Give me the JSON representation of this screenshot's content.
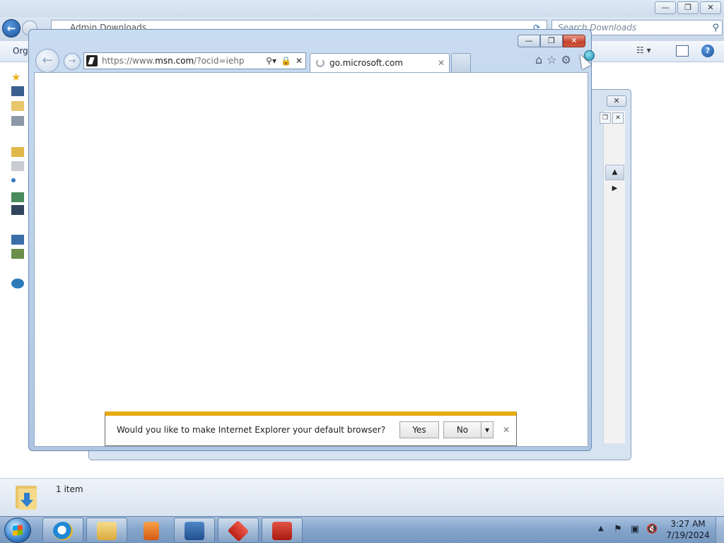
{
  "explorer": {
    "breadcrumb": [
      "Admin",
      "Downloads"
    ],
    "search_placeholder": "Search Downloads",
    "toolbar": {
      "organize_label": "Organize ▾",
      "views_icon": "views-icon",
      "pane_icon": "preview-pane-icon",
      "help_label": "?"
    },
    "title_buttons": {
      "minimize": "—",
      "restore": "❐",
      "close": "✕"
    },
    "status": {
      "item_count": "1 item"
    }
  },
  "ie": {
    "title_buttons": {
      "minimize": "—",
      "restore": "❐",
      "close": "✕"
    },
    "address": {
      "prefix": "https://www.",
      "domain": "msn.com",
      "suffix": "/?ocid=iehp"
    },
    "address_tools": {
      "search": "⚲▾",
      "lock": "🔒",
      "stop": "✕"
    },
    "tab": {
      "label": "go.microsoft.com",
      "close": "✕"
    },
    "commands": {
      "home": "⌂",
      "favorites": "☆",
      "tools": "⚙"
    },
    "notification": {
      "message": "Would you like to make Internet Explorer your default browser?",
      "yes_label": "Yes",
      "no_label": "No",
      "dropdown_label": "▾",
      "close_label": "✕"
    }
  },
  "taskbar": {
    "apps": [
      "internet-explorer",
      "windows-explorer",
      "media-player",
      "server-manager",
      "toolbox",
      "toolbox-2"
    ],
    "tray_arrow": "▲",
    "time": "3:27 AM",
    "date": "7/19/2024"
  },
  "colors": {
    "notification_accent": "#e6aa12",
    "close_red": "#c4402b",
    "taskbar": "#86a6cc"
  }
}
